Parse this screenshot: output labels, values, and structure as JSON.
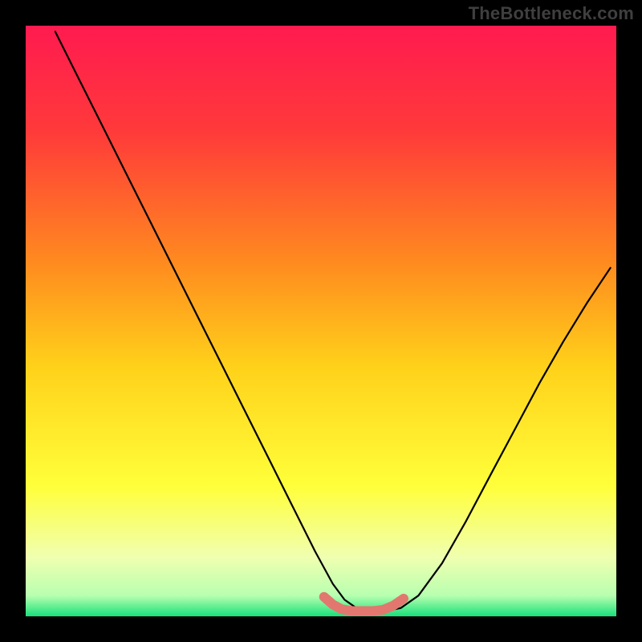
{
  "watermark": "TheBottleneck.com",
  "chart_data": {
    "type": "line",
    "title": "",
    "xlabel": "",
    "ylabel": "",
    "xlim": [
      0,
      1
    ],
    "ylim": [
      0,
      1
    ],
    "background_gradient": {
      "stops": [
        {
          "offset": 0.0,
          "color": "#ff1a4f"
        },
        {
          "offset": 0.18,
          "color": "#ff3a3a"
        },
        {
          "offset": 0.4,
          "color": "#ff8a1f"
        },
        {
          "offset": 0.58,
          "color": "#ffd21a"
        },
        {
          "offset": 0.78,
          "color": "#ffff3a"
        },
        {
          "offset": 0.9,
          "color": "#f0ffb0"
        },
        {
          "offset": 0.965,
          "color": "#b8ffb0"
        },
        {
          "offset": 1.0,
          "color": "#18e07a"
        }
      ]
    },
    "series": [
      {
        "name": "bottleneck-curve",
        "stroke": "#000000",
        "stroke_width": 2.2,
        "x": [
          0.05,
          0.09,
          0.13,
          0.17,
          0.21,
          0.25,
          0.29,
          0.33,
          0.37,
          0.41,
          0.45,
          0.49,
          0.52,
          0.54,
          0.56,
          0.585,
          0.61,
          0.635,
          0.665,
          0.705,
          0.745,
          0.79,
          0.83,
          0.87,
          0.91,
          0.95,
          0.99
        ],
        "y": [
          0.99,
          0.91,
          0.83,
          0.75,
          0.67,
          0.59,
          0.51,
          0.43,
          0.35,
          0.27,
          0.19,
          0.11,
          0.055,
          0.028,
          0.014,
          0.009,
          0.009,
          0.014,
          0.035,
          0.09,
          0.16,
          0.245,
          0.32,
          0.395,
          0.465,
          0.53,
          0.59
        ]
      },
      {
        "name": "sweet-spot-band",
        "stroke": "#e2776f",
        "stroke_width": 12,
        "linecap": "round",
        "x": [
          0.505,
          0.52,
          0.535,
          0.552,
          0.57,
          0.588,
          0.605,
          0.622,
          0.64
        ],
        "y": [
          0.033,
          0.02,
          0.012,
          0.009,
          0.009,
          0.009,
          0.011,
          0.018,
          0.03
        ]
      }
    ]
  }
}
